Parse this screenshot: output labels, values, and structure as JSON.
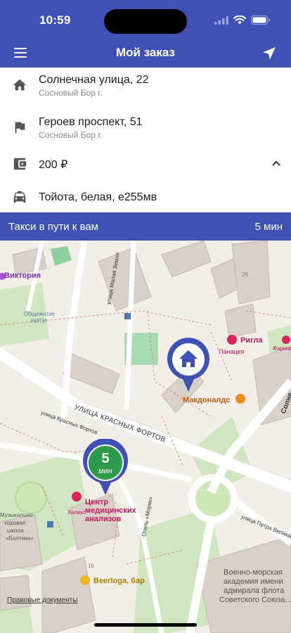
{
  "status_bar": {
    "time": "10:59"
  },
  "nav": {
    "title": "Мой заказ",
    "menu_icon": "hamburger-icon",
    "locate_icon": "navigation-arrow-icon"
  },
  "order": {
    "pickup": {
      "address": "Солнечная улица, 22",
      "city": "Сосновый Бор г.",
      "icon": "home-icon"
    },
    "destination": {
      "address": "Героев проспект, 51",
      "city": "Сосновый Бор г.",
      "icon": "flag-icon"
    },
    "price": {
      "value": "200 ₽",
      "icon": "wallet-icon"
    },
    "car": {
      "description": "Тойота, белая, е255мв",
      "icon": "taxi-icon"
    }
  },
  "status": {
    "text": "Такси в пути к вам",
    "eta": "5 мин"
  },
  "map": {
    "car_marker": {
      "minutes": "5",
      "unit": "мин"
    },
    "labels": {
      "viktoria": "Виктория",
      "obshezhitie": "Общежитие",
      "niti": "НИТИ",
      "rigla": "Ригла",
      "panaceya": "Панацея",
      "farmakon": "Фармакон",
      "mcdonalds": "Макдоналдс",
      "krasnykh_fortov_street": "УЛИЦА КРАСНЫХ ФОРТОВ",
      "krasnykh_fortov_small": "улица Красных Фортов",
      "malaya_zemlya": "улица Малая Земля",
      "center_line1": "Центр",
      "center_line2": "медицинских",
      "center_line3": "анализов",
      "helix": "Хеликс",
      "music_line1": "Музыкально-",
      "music_line2": "хоровая",
      "music_line3": "школа",
      "music_line4": "«Балтика»",
      "beerloga": "Beerloga, бар",
      "moryak": "Отель «Моряк»",
      "petra_velikogo": "улица Петра Великого",
      "navy_line1": "Военно-морская",
      "navy_line2": "академия имени",
      "navy_line3": "адмирала флота",
      "navy_line4": "Советского Союза...",
      "solnechnaya": "Солне",
      "house_16": "16",
      "house_26": "26",
      "legal": "Правовые документы"
    }
  },
  "colors": {
    "primary": "#3f51b5",
    "marker_green": "#2e9b4b",
    "park": "#c8e6b0",
    "pharmacy": "#d9255d"
  }
}
